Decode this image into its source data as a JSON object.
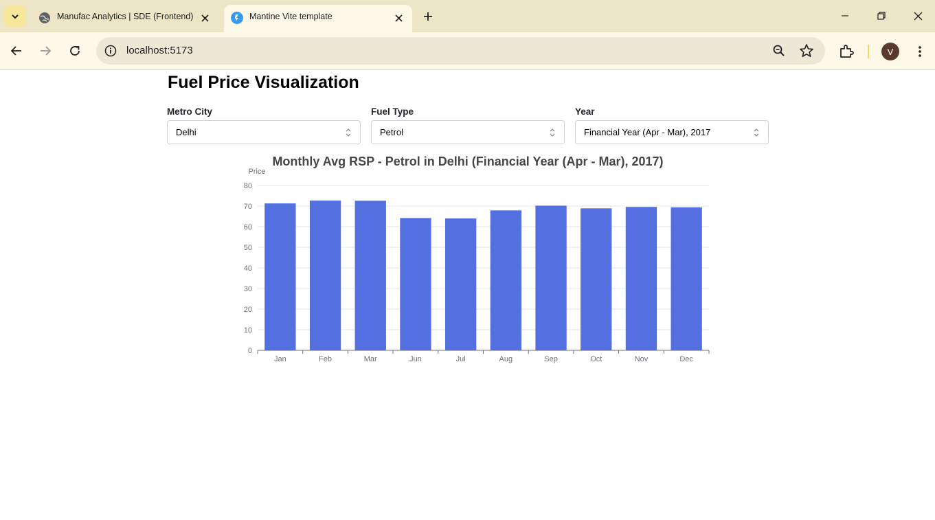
{
  "browser": {
    "tabs": [
      {
        "title": "Manufac Analytics | SDE (Frontend) As",
        "favicon": "globe-icon",
        "active": false
      },
      {
        "title": "Mantine Vite template",
        "favicon": "vite-icon",
        "active": true
      }
    ],
    "url": "localhost:5173",
    "profile_initial": "V"
  },
  "page": {
    "title": "Fuel Price Visualization",
    "filters": {
      "city": {
        "label": "Metro City",
        "value": "Delhi"
      },
      "fuel": {
        "label": "Fuel Type",
        "value": "Petrol"
      },
      "year": {
        "label": "Year",
        "value": "Financial Year (Apr - Mar), 2017"
      }
    }
  },
  "colors": {
    "bar": "#5470e0",
    "tabbar": "#ece5c6",
    "toolbar": "#fdf8e8"
  },
  "chart_data": {
    "type": "bar",
    "title": "Monthly Avg RSP - Petrol in Delhi (Financial Year (Apr - Mar), 2017)",
    "ylabel": "Price",
    "xlabel": "",
    "ylim": [
      0,
      80
    ],
    "yticks": [
      0,
      10,
      20,
      30,
      40,
      50,
      60,
      70,
      80
    ],
    "grid": true,
    "categories": [
      "Jan",
      "Feb",
      "Mar",
      "Jun",
      "Jul",
      "Aug",
      "Sep",
      "Oct",
      "Nov",
      "Dec"
    ],
    "values": [
      71.3,
      72.7,
      72.6,
      64.2,
      64.0,
      67.9,
      70.2,
      68.9,
      69.6,
      69.4
    ]
  }
}
